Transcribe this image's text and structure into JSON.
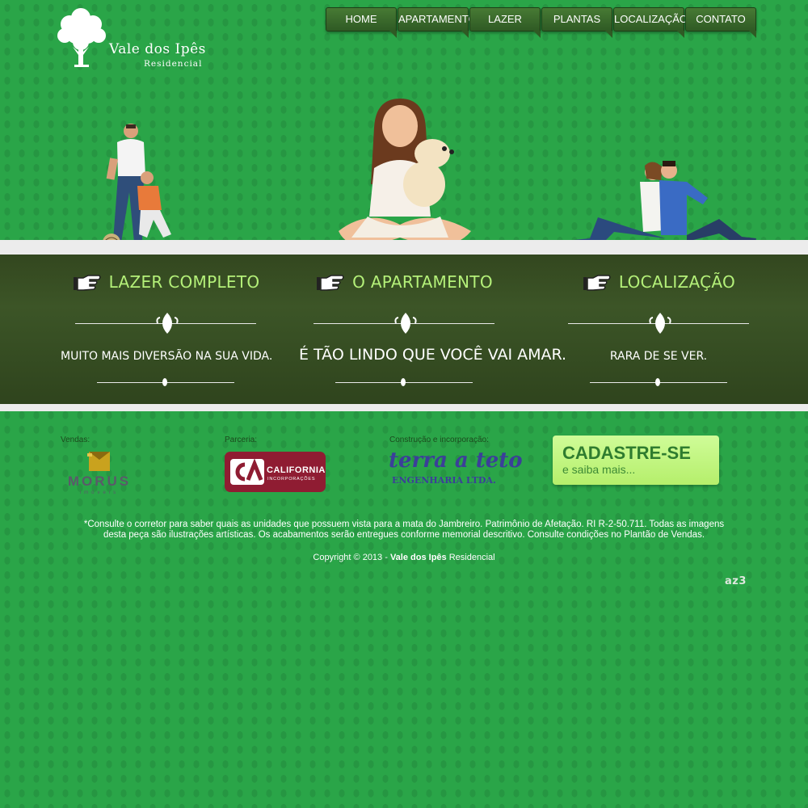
{
  "brand": {
    "name": "Vale dos Ipês",
    "sub": "Residencial"
  },
  "nav": [
    {
      "label": "HOME"
    },
    {
      "label": "APARTAMENTO"
    },
    {
      "label": "LAZER"
    },
    {
      "label": "PLANTAS"
    },
    {
      "label": "LOCALIZAÇÃO"
    },
    {
      "label": "CONTATO"
    }
  ],
  "features": [
    {
      "title": "LAZER COMPLETO",
      "tagline": "MUITO MAIS DIVERSÃO NA SUA VIDA."
    },
    {
      "title": "O APARTAMENTO",
      "tagline": "É TÃO LINDO QUE VOCÊ VAI AMAR."
    },
    {
      "title": "LOCALIZAÇÃO",
      "tagline": "RARA DE SE VER."
    }
  ],
  "partners": {
    "vendas": {
      "label": "Vendas:",
      "logo_text": "MORUS",
      "logo_sub": "imóveis"
    },
    "parceria": {
      "label": "Parceria:",
      "logo_text": "CALIFORNIA",
      "logo_sub": "INCORPORAÇÕES"
    },
    "construcao": {
      "label": "Construção e incorporação:",
      "logo_text": "terra a teto",
      "logo_sub": "ENGENHARIA LTDA."
    }
  },
  "cta": {
    "title": "CADASTRE-SE",
    "subtitle": "e saiba mais..."
  },
  "footer": {
    "disclaimer": "*Consulte o corretor para saber quais as unidades que possuem vista para a mata do Jambreiro. Patrimônio de Afetação. RI R-2-50.711. Todas as imagens desta peça são ilustrações artísticas. Os acabamentos serão entregues conforme memorial descritivo. Consulte condições no Plantão de Vendas.",
    "copyright_prefix": "Copyright © 2013 - ",
    "copyright_bold": "Vale dos Ipês",
    "copyright_suffix": " Residencial",
    "agency": "az3"
  },
  "colors": {
    "background": "#2aa548",
    "band": "#3c5527",
    "accent_green": "#b4f079",
    "cta": "#c2f47f"
  }
}
